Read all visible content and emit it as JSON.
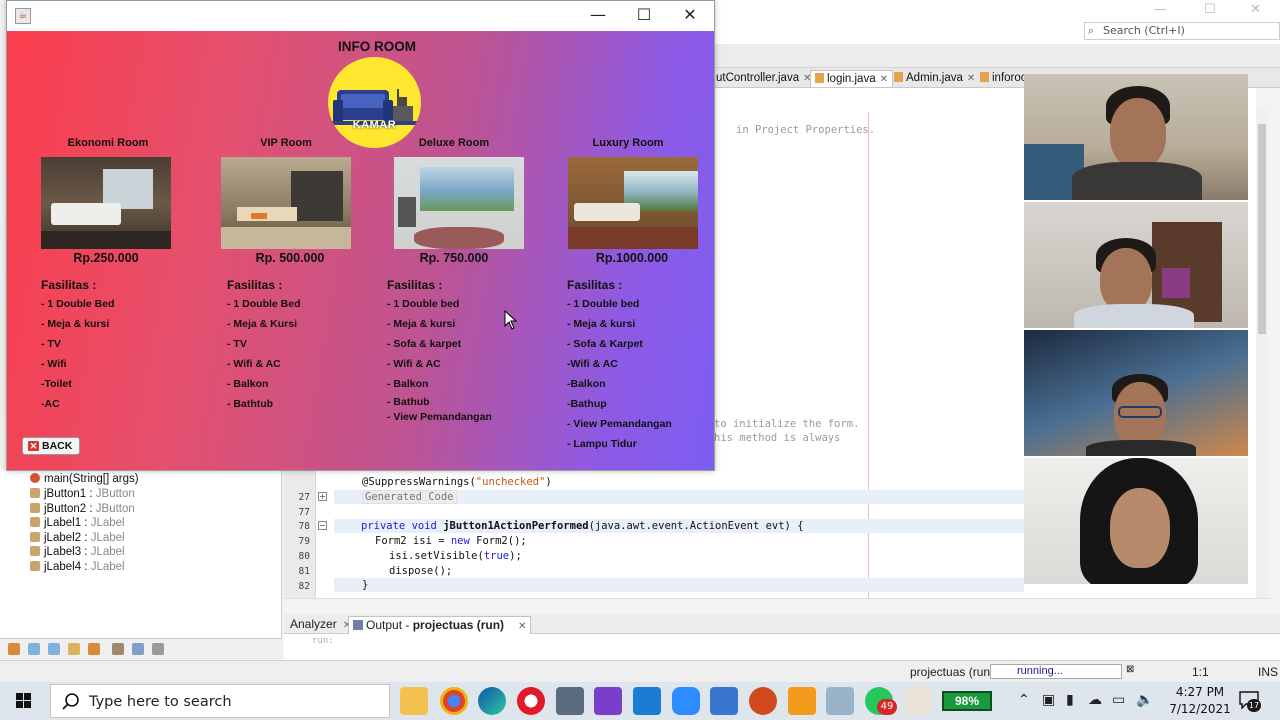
{
  "ide": {
    "search_placeholder": "Search (Ctrl+I)",
    "editor_tabs": [
      {
        "label": "utController.java"
      },
      {
        "label": "login.java"
      },
      {
        "label": "Admin.java"
      },
      {
        "label": "inforoo"
      }
    ],
    "code_hints": {
      "line1": "in Project Properties.",
      "line2": "to initialize the form.",
      "line3": "his method is always"
    },
    "code_lines": [
      {
        "num": "",
        "text": "@SuppressWarnings(\"unchecked\")"
      },
      {
        "num": "27",
        "text": "Generated Code"
      },
      {
        "num": "77",
        "text": ""
      },
      {
        "num": "78",
        "text": "private void jButton1ActionPerformed(java.awt.event.ActionEvent evt) {"
      },
      {
        "num": "79",
        "text": "Form2 isi = new Form2();"
      },
      {
        "num": "80",
        "text": "isi.setVisible(true);"
      },
      {
        "num": "81",
        "text": "dispose();"
      },
      {
        "num": "82",
        "text": "}"
      }
    ],
    "navigator_items": [
      {
        "name": "main(String[] args)",
        "type": ""
      },
      {
        "name": "jButton1",
        "type": "JButton"
      },
      {
        "name": "jButton2",
        "type": "JButton"
      },
      {
        "name": "jLabel1",
        "type": "JLabel"
      },
      {
        "name": "jLabel2",
        "type": "JLabel"
      },
      {
        "name": "jLabel3",
        "type": "JLabel"
      },
      {
        "name": "jLabel4",
        "type": "JLabel"
      }
    ],
    "output_tabs": [
      {
        "label": "Analyzer"
      },
      {
        "label": "Output - ",
        "bold": "projectuas (run)"
      }
    ],
    "output_text": "run:",
    "status": {
      "project": "projectuas (run)",
      "progress": "running...",
      "position": "1:1",
      "mode": "INS"
    }
  },
  "app": {
    "title": "INFO ROOM",
    "logo_text": "KAMAR",
    "back_label": "BACK",
    "facilities_heading": "Fasilitas :",
    "rooms": [
      {
        "name": "Ekonomi Room",
        "price": "Rp.250.000",
        "facilities": [
          "- 1 Double Bed",
          "- Meja & kursi",
          "- TV",
          "- Wifi",
          "-Toilet",
          "-AC"
        ]
      },
      {
        "name": "VIP Room",
        "price": "Rp. 500.000",
        "facilities": [
          "- 1 Double Bed",
          "- Meja & Kursi",
          "- TV",
          "- Wifi & AC",
          "- Balkon",
          "- Bathtub"
        ]
      },
      {
        "name": "Deluxe Room",
        "price": "Rp. 750.000",
        "facilities": [
          "- 1 Double bed",
          "- Meja & kursi",
          "- Sofa & karpet",
          "- Wifi & AC",
          "- Balkon",
          "- Bathub",
          "- View Pemandangan"
        ]
      },
      {
        "name": "Luxury Room",
        "price": "Rp.1000.000",
        "facilities": [
          "- 1 Double bed",
          "- Meja & kursi",
          "- Sofa  & Karpet",
          "-Wifi & AC",
          "-Balkon",
          "-Bathup",
          "- View Pemandangan",
          "- Lampu Tidur"
        ]
      }
    ]
  },
  "taskbar": {
    "search_placeholder": "Type here to search",
    "battery": "98%",
    "whatsapp_badge": "49",
    "time": "4:27 PM",
    "date": "7/12/2021",
    "notifications": "17"
  }
}
